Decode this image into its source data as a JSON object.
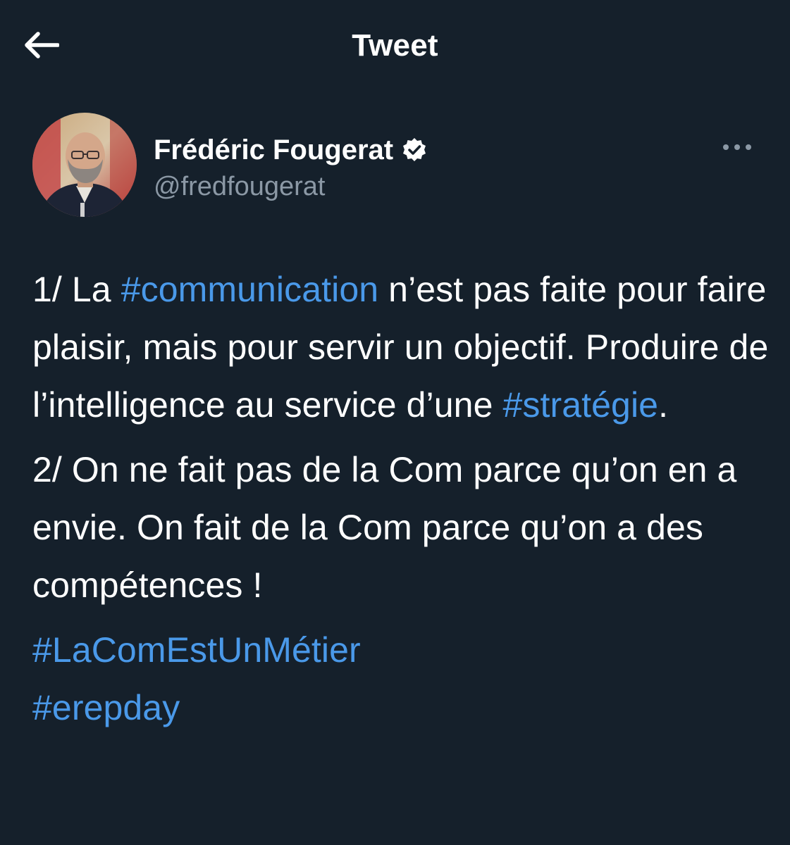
{
  "header": {
    "title": "Tweet",
    "back_icon": "arrow-left-icon"
  },
  "author": {
    "display_name": "Frédéric Fougerat",
    "handle": "@fredfougerat",
    "verified_icon": "verified-badge-icon",
    "more_icon": "more-horizontal-icon"
  },
  "tweet": {
    "p1": {
      "t1": "1/ La ",
      "h1": "#communication",
      "t2": " n’est pas faite pour faire plaisir, mais pour servir un objectif. Produire de l’intelligence au service d’une ",
      "h2": "#stratégie",
      "t3": "."
    },
    "p2": {
      "text": "2/ On ne fait pas de la Com parce qu’on en a envie. On fait de la Com parce qu’on a des compétences !"
    },
    "tags": [
      "#LaComEstUnMétier",
      "#erepday"
    ]
  },
  "colors": {
    "background": "#15202b",
    "link": "#4a99e9",
    "secondary_text": "#8b98a5"
  }
}
